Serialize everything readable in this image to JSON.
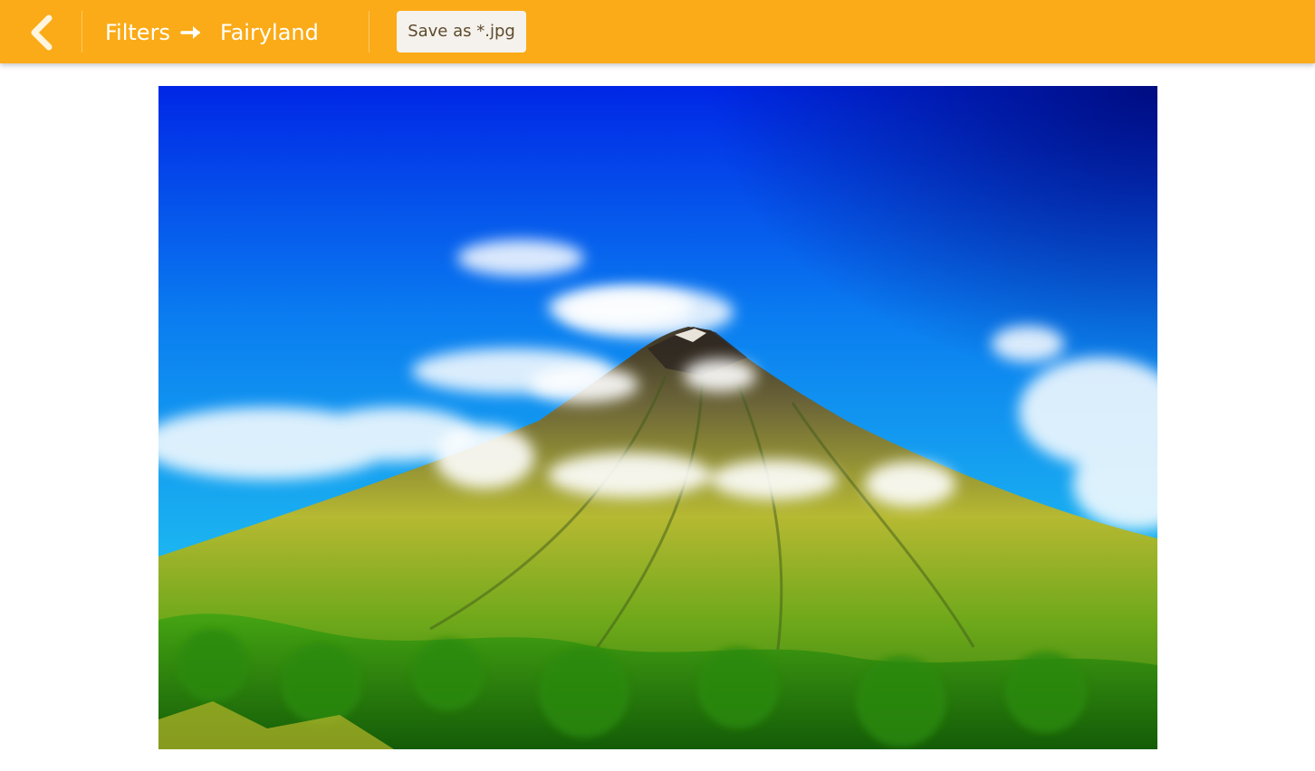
{
  "toolbar": {
    "back_icon": "chevron-left-icon",
    "breadcrumb_parent": "Filters",
    "breadcrumb_arrow_icon": "arrow-right-icon",
    "breadcrumb_current": "Fairyland",
    "save_label": "Save as *.jpg",
    "accent_color": "#fbab17"
  },
  "photo": {
    "subject": "mountain-landscape-photo"
  }
}
